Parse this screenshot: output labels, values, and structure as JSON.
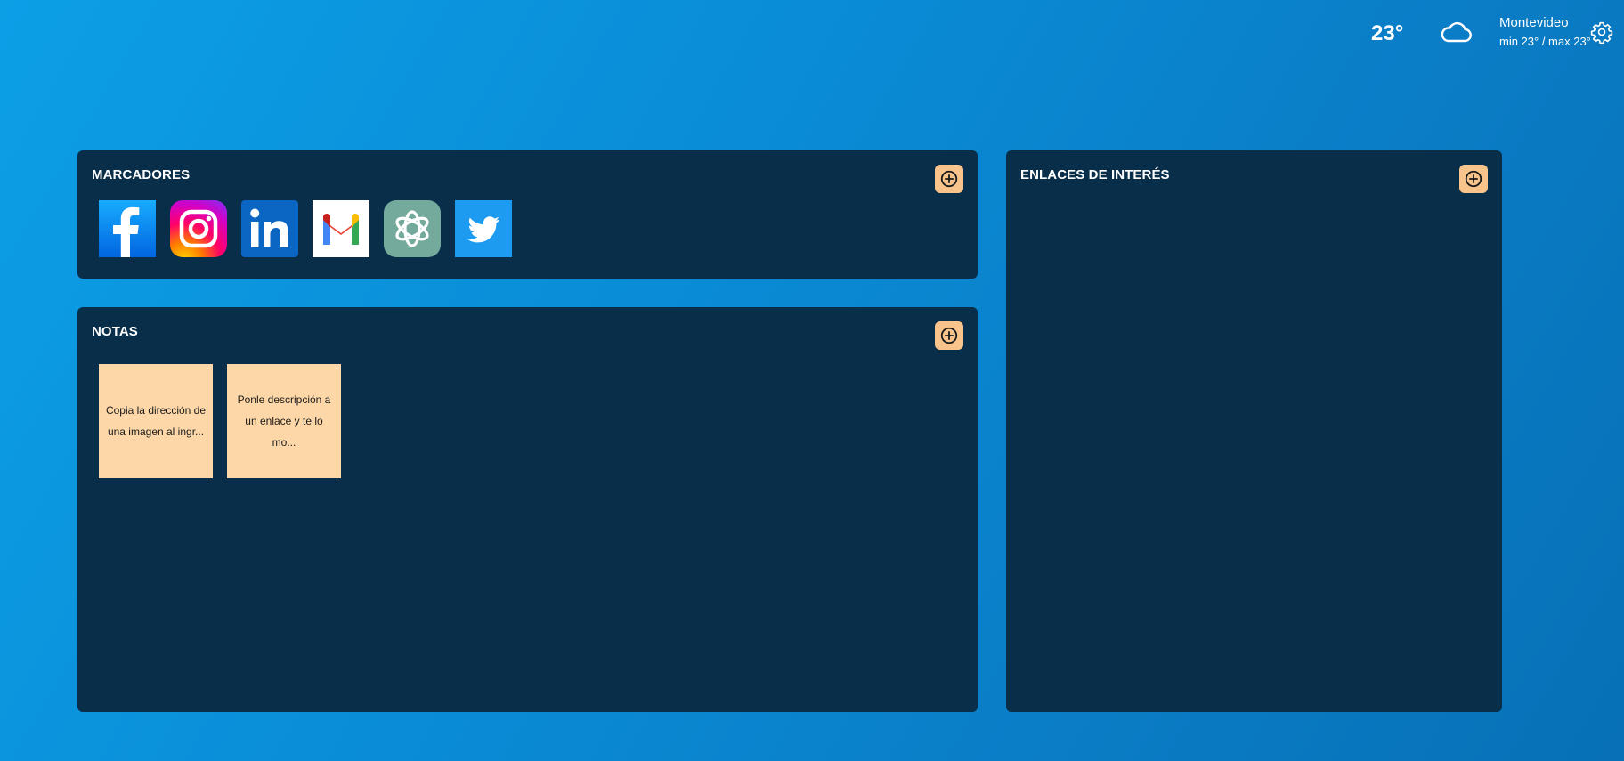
{
  "weather": {
    "temperature": "23°",
    "condition_icon": "cloud-icon",
    "city": "Montevideo",
    "minmax": "min 23° / max 23°",
    "settings_icon": "gear-icon"
  },
  "bookmarks": {
    "title": "MARCADORES",
    "add_icon": "plus-circle-icon",
    "items": [
      {
        "icon": "facebook-icon",
        "color": "#1877f2"
      },
      {
        "icon": "instagram-icon",
        "color": "#e1306c"
      },
      {
        "icon": "linkedin-icon",
        "color": "#0a66c2"
      },
      {
        "icon": "gmail-icon",
        "color": "#ffffff"
      },
      {
        "icon": "chatgpt-icon",
        "color": "#74aa9c"
      },
      {
        "icon": "twitter-icon",
        "color": "#1d9bf0"
      }
    ]
  },
  "notes": {
    "title": "NOTAS",
    "add_icon": "plus-circle-icon",
    "items": [
      {
        "text": "Copia la dirección de una imagen al ingr..."
      },
      {
        "text": "Ponle descripción a un enlace y te lo mo..."
      }
    ]
  },
  "links": {
    "title": "ENLACES DE INTERÉS",
    "add_icon": "plus-circle-icon"
  },
  "colors": {
    "panel_bg": "#082e4a",
    "accent": "#f9c48b",
    "note_bg": "#fdd7a7"
  }
}
